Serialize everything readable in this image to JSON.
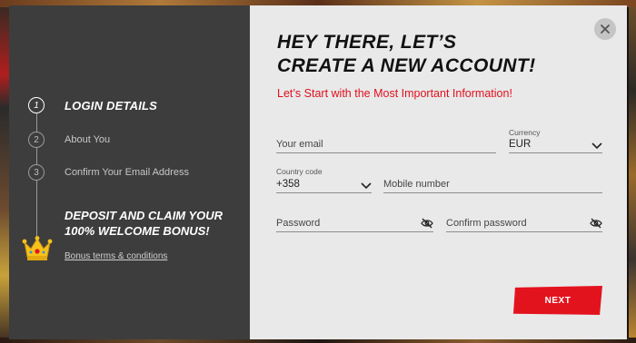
{
  "steps": [
    {
      "number": "1",
      "label": "LOGIN DETAILS",
      "active": true
    },
    {
      "number": "2",
      "label": "About You",
      "active": false
    },
    {
      "number": "3",
      "label": "Confirm Your Email Address",
      "active": false
    }
  ],
  "bonus": {
    "title": "DEPOSIT AND CLAIM YOUR 100% WELCOME BONUS!",
    "link": "Bonus terms & conditions"
  },
  "header": {
    "title_line1": "HEY THERE, LET’S",
    "title_line2": "CREATE A NEW ACCOUNT!",
    "subtitle": "Let’s Start with the Most Important Information!"
  },
  "form": {
    "email_placeholder": "Your email",
    "currency_label": "Currency",
    "currency_value": "EUR",
    "country_code_label": "Country code",
    "country_code_value": "+358",
    "mobile_placeholder": "Mobile number",
    "password_placeholder": "Password",
    "confirm_password_placeholder": "Confirm password"
  },
  "actions": {
    "next_label": "NEXT"
  },
  "colors": {
    "accent": "#e3131e",
    "panel_dark": "#3d3d3d",
    "panel_light": "#e9e9e9"
  },
  "icons": [
    "close-icon",
    "chevron-down-icon",
    "eye-hidden-icon",
    "crown-icon"
  ]
}
